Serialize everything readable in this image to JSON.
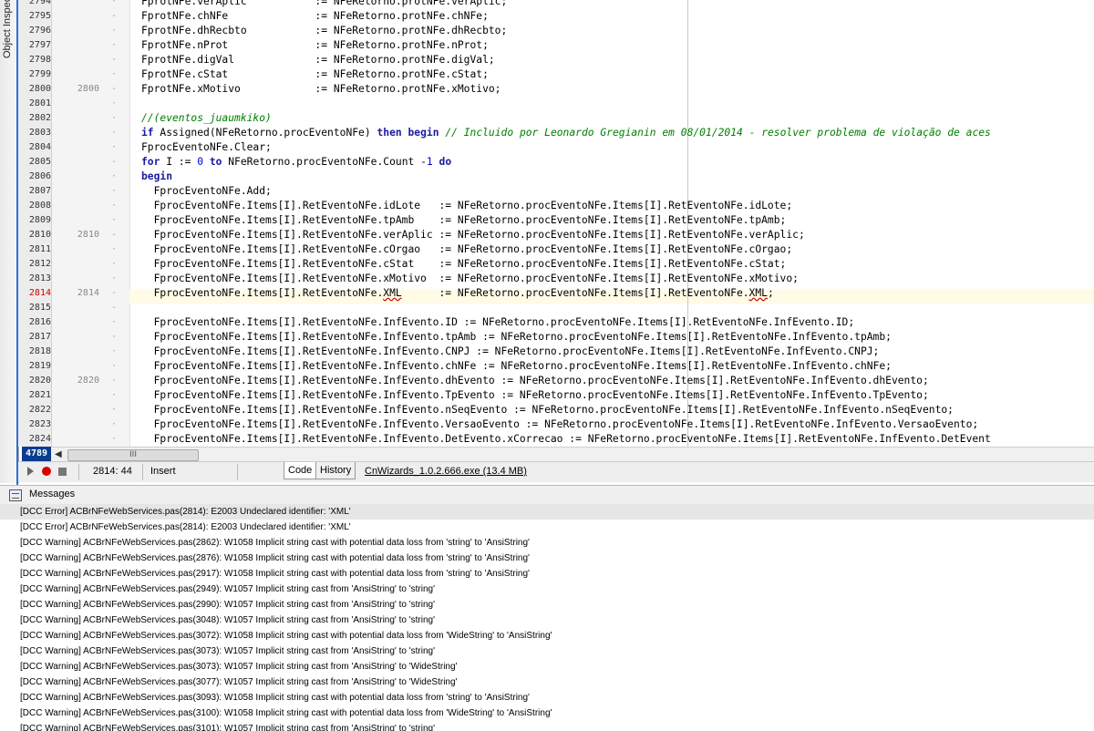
{
  "side_panel": {
    "label": "Object Inspector"
  },
  "editor": {
    "line_count_badge": "4789",
    "hscroll_thumb": "III",
    "gutter_lines": [
      "2794",
      "2795",
      "2796",
      "2797",
      "2798",
      "2799",
      "2800",
      "2801",
      "2802",
      "2803",
      "2804",
      "2805",
      "2806",
      "2807",
      "2808",
      "2809",
      "2810",
      "2811",
      "2812",
      "2813",
      "2814",
      "2815",
      "2816",
      "2817",
      "2818",
      "2819",
      "2820",
      "2821",
      "2822",
      "2823",
      "2824"
    ],
    "module_marks": [
      "",
      "-",
      "",
      "",
      "",
      "",
      "2800",
      "",
      "",
      "",
      "",
      "-",
      "",
      "",
      "",
      "",
      "2810",
      "",
      "",
      "",
      "2814",
      "-",
      "",
      "",
      "",
      "",
      "2820",
      "",
      "",
      "",
      ""
    ],
    "code_lines": [
      "FprotNFe.verAplic           := NFeRetorno.protNFe.verAplic;",
      "FprotNFe.chNFe              := NFeRetorno.protNFe.chNFe;",
      "FprotNFe.dhRecbto           := NFeRetorno.protNFe.dhRecbto;",
      "FprotNFe.nProt              := NFeRetorno.protNFe.nProt;",
      "FprotNFe.digVal             := NFeRetorno.protNFe.digVal;",
      "FprotNFe.cStat              := NFeRetorno.protNFe.cStat;",
      "FprotNFe.xMotivo            := NFeRetorno.protNFe.xMotivo;",
      "",
      "//(eventos_juaumkiko)",
      "if Assigned(NFeRetorno.procEventoNFe) then begin // Incluido por Leonardo Gregianin em 08/01/2014 - resolver problema de violação de aces",
      "FprocEventoNFe.Clear;",
      "for I := 0 to NFeRetorno.procEventoNFe.Count -1 do",
      "begin",
      "  FprocEventoNFe.Add;",
      "  FprocEventoNFe.Items[I].RetEventoNFe.idLote   := NFeRetorno.procEventoNFe.Items[I].RetEventoNFe.idLote;",
      "  FprocEventoNFe.Items[I].RetEventoNFe.tpAmb    := NFeRetorno.procEventoNFe.Items[I].RetEventoNFe.tpAmb;",
      "  FprocEventoNFe.Items[I].RetEventoNFe.verAplic := NFeRetorno.procEventoNFe.Items[I].RetEventoNFe.verAplic;",
      "  FprocEventoNFe.Items[I].RetEventoNFe.cOrgao   := NFeRetorno.procEventoNFe.Items[I].RetEventoNFe.cOrgao;",
      "  FprocEventoNFe.Items[I].RetEventoNFe.cStat    := NFeRetorno.procEventoNFe.Items[I].RetEventoNFe.cStat;",
      "  FprocEventoNFe.Items[I].RetEventoNFe.xMotivo  := NFeRetorno.procEventoNFe.Items[I].RetEventoNFe.xMotivo;",
      "  FprocEventoNFe.Items[I].RetEventoNFe.XML      := NFeRetorno.procEventoNFe.Items[I].RetEventoNFe.XML;",
      "",
      "  FprocEventoNFe.Items[I].RetEventoNFe.InfEvento.ID := NFeRetorno.procEventoNFe.Items[I].RetEventoNFe.InfEvento.ID;",
      "  FprocEventoNFe.Items[I].RetEventoNFe.InfEvento.tpAmb := NFeRetorno.procEventoNFe.Items[I].RetEventoNFe.InfEvento.tpAmb;",
      "  FprocEventoNFe.Items[I].RetEventoNFe.InfEvento.CNPJ := NFeRetorno.procEventoNFe.Items[I].RetEventoNFe.InfEvento.CNPJ;",
      "  FprocEventoNFe.Items[I].RetEventoNFe.InfEvento.chNFe := NFeRetorno.procEventoNFe.Items[I].RetEventoNFe.InfEvento.chNFe;",
      "  FprocEventoNFe.Items[I].RetEventoNFe.InfEvento.dhEvento := NFeRetorno.procEventoNFe.Items[I].RetEventoNFe.InfEvento.dhEvento;",
      "  FprocEventoNFe.Items[I].RetEventoNFe.InfEvento.TpEvento := NFeRetorno.procEventoNFe.Items[I].RetEventoNFe.InfEvento.TpEvento;",
      "  FprocEventoNFe.Items[I].RetEventoNFe.InfEvento.nSeqEvento := NFeRetorno.procEventoNFe.Items[I].RetEventoNFe.InfEvento.nSeqEvento;",
      "  FprocEventoNFe.Items[I].RetEventoNFe.InfEvento.VersaoEvento := NFeRetorno.procEventoNFe.Items[I].RetEventoNFe.InfEvento.VersaoEvento;",
      "  FprocEventoNFe.Items[I].RetEventoNFe.InfEvento.DetEvento.xCorrecao := NFeRetorno.procEventoNFe.Items[I].RetEventoNFe.InfEvento.DetEvent"
    ],
    "error_line": "2814"
  },
  "statusbar": {
    "position": "2814: 44",
    "mode": "Insert",
    "tab_code": "Code",
    "tab_history": "History",
    "cnwizards_link": "CnWizards_1.0.2.666.exe (13.4 MB)"
  },
  "messages": {
    "title": "Messages",
    "items": [
      "[DCC Error] ACBrNFeWebServices.pas(2814): E2003 Undeclared identifier: 'XML'",
      "[DCC Error] ACBrNFeWebServices.pas(2814): E2003 Undeclared identifier: 'XML'",
      "[DCC Warning] ACBrNFeWebServices.pas(2862): W1058 Implicit string cast with potential data loss from 'string' to 'AnsiString'",
      "[DCC Warning] ACBrNFeWebServices.pas(2876): W1058 Implicit string cast with potential data loss from 'string' to 'AnsiString'",
      "[DCC Warning] ACBrNFeWebServices.pas(2917): W1058 Implicit string cast with potential data loss from 'string' to 'AnsiString'",
      "[DCC Warning] ACBrNFeWebServices.pas(2949): W1057 Implicit string cast from 'AnsiString' to 'string'",
      "[DCC Warning] ACBrNFeWebServices.pas(2990): W1057 Implicit string cast from 'AnsiString' to 'string'",
      "[DCC Warning] ACBrNFeWebServices.pas(3048): W1057 Implicit string cast from 'AnsiString' to 'string'",
      "[DCC Warning] ACBrNFeWebServices.pas(3072): W1058 Implicit string cast with potential data loss from 'WideString' to 'AnsiString'",
      "[DCC Warning] ACBrNFeWebServices.pas(3073): W1057 Implicit string cast from 'AnsiString' to 'string'",
      "[DCC Warning] ACBrNFeWebServices.pas(3073): W1057 Implicit string cast from 'AnsiString' to 'WideString'",
      "[DCC Warning] ACBrNFeWebServices.pas(3077): W1057 Implicit string cast from 'AnsiString' to 'WideString'",
      "[DCC Warning] ACBrNFeWebServices.pas(3093): W1058 Implicit string cast with potential data loss from 'string' to 'AnsiString'",
      "[DCC Warning] ACBrNFeWebServices.pas(3100): W1058 Implicit string cast with potential data loss from 'WideString' to 'AnsiString'",
      "[DCC Warning] ACBrNFeWebServices.pas(3101): W1057 Implicit string cast from 'AnsiString' to 'string'"
    ]
  }
}
